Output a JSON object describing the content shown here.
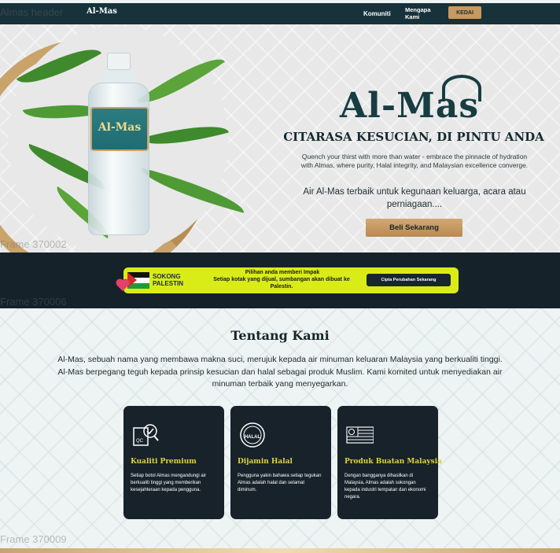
{
  "header": {
    "frame_label": "Almas header",
    "logo": "Al-Mas",
    "nav": {
      "komuniti": "Komuniti",
      "mengapa": "Mengapa Kami"
    },
    "shop_button": "KEDAI"
  },
  "hero": {
    "frame_label": "Frame 370002",
    "bottle_label": "Al-Mas",
    "brand": "Al-Mas",
    "headline": "CITARASA KESUCIAN, DI PINTU ANDA",
    "subtitle": "Quench your thirst with more than water - embrace the pinnacle of hydration with Almas, where purity, Halal integrity, and Malaysian excellence converge.",
    "subtitle_ms": "Air Al-Mas terbaik untuk kegunaan keluarga, acara atau perniagaan....",
    "cta": "Beli Sekarang"
  },
  "palestine": {
    "frame_label": "Frame 370006",
    "brand": [
      "SOKONG",
      "PALESTIN"
    ],
    "title": "Pilihan anda memberi Impak",
    "description": "Setiap kotak yang dijual,  sumbangan akan dibuat ke Palestin.",
    "button": "Cipta Perubahan Sekarang"
  },
  "about": {
    "frame_label": "Frame 370009",
    "title": "Tentang Kami",
    "description": "Al-Mas, sebuah nama yang membawa makna suci, merujuk kepada air minuman keluaran Malaysia yang berkualiti tinggi. Al-Mas berpegang teguh kepada prinsip kesucian dan halal sebagai produk Muslim. Kami komited untuk menyediakan air minuman terbaik yang menyegarkan.",
    "cards": [
      {
        "icon": "quality-check-icon",
        "title": "Kualiti Premium",
        "text": "Setiap botol Almas mengandungi air berkualiti tinggi yang memberikan kesejahteraan kepada pengguna."
      },
      {
        "icon": "halal-seal-icon",
        "title": "Dijamin Halal",
        "icon_text": "HALAL",
        "text": "Pengguna yakin bahawa setiap tegukan Almas adalah halal dan selamat diminum."
      },
      {
        "icon": "malaysia-flag-icon",
        "title": "Produk Buatan Malaysia",
        "text": "Dengan bangganya dihasilkan di Malaysia, Almas adalah sokongan kepada industri tempatan dan ekonomi negara."
      }
    ]
  },
  "colors": {
    "dark": "#17222a",
    "gold": "#c69a61",
    "lime": "#d9ec17",
    "card_title": "#e1d23c"
  }
}
